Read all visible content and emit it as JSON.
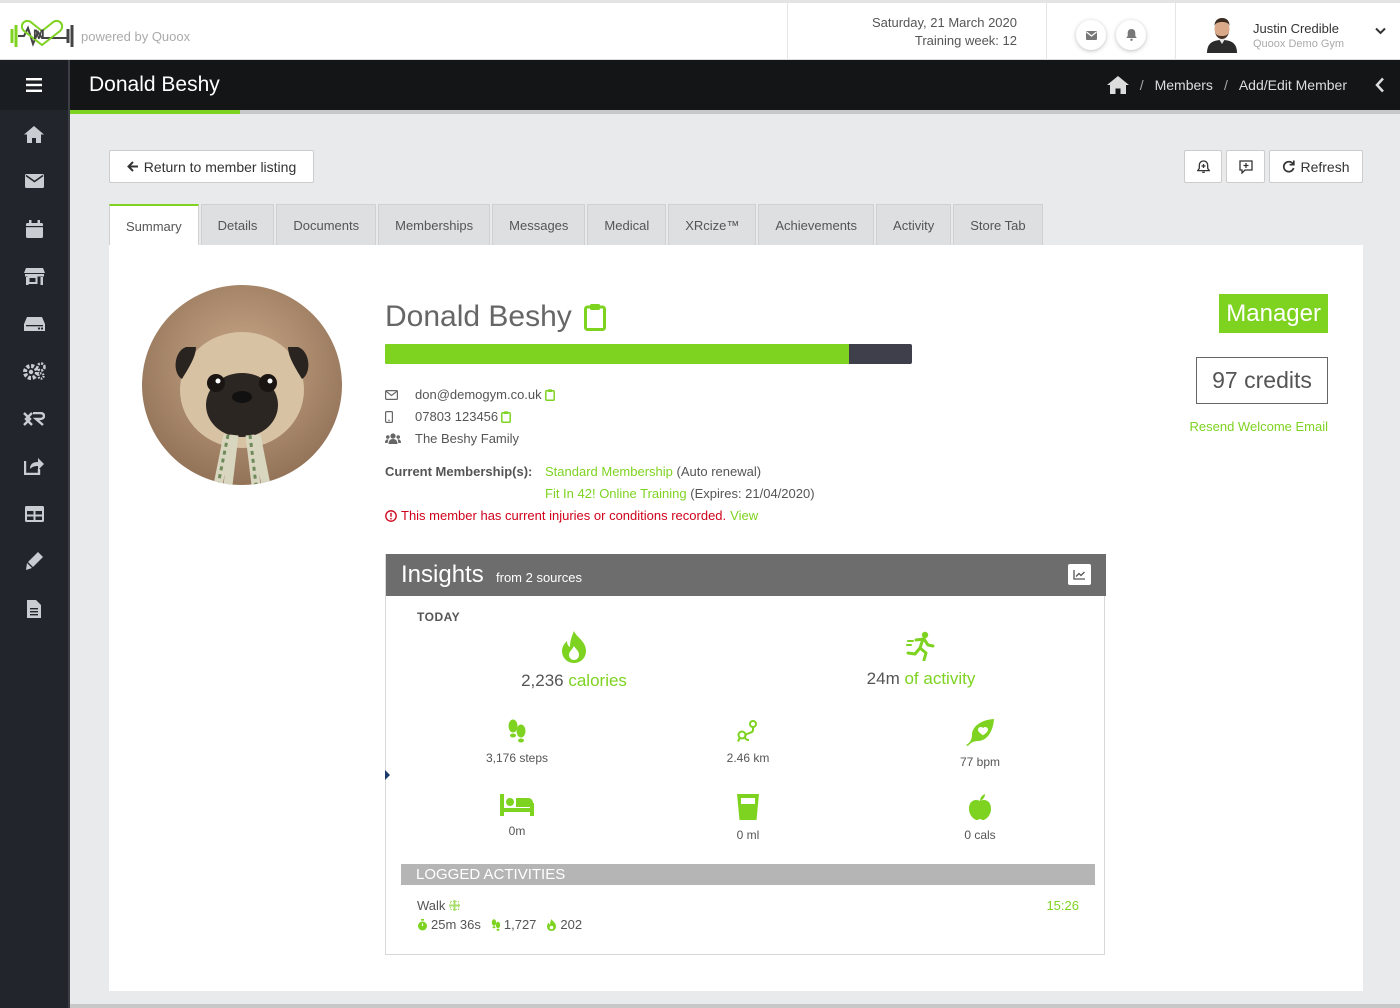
{
  "topbar": {
    "powered_by": "powered by Quoox",
    "date": "Saturday, 21 March 2020",
    "training_week": "Training week: 12",
    "user_name": "Justin Credible",
    "user_gym": "Quoox Demo Gym"
  },
  "sidebar": {
    "items": [
      "home-icon",
      "envelope-icon",
      "calendar-icon",
      "store-icon",
      "gear-icon",
      "xr-icon",
      "share-icon",
      "table-icon",
      "pen-icon",
      "document-icon"
    ]
  },
  "titlebar": {
    "title": "Donald Beshy",
    "breadcrumb_members": "Members",
    "breadcrumb_current": "Add/Edit Member",
    "separator": "/"
  },
  "actions": {
    "return_label": "Return to member listing",
    "refresh_label": "Refresh"
  },
  "tabs": [
    {
      "label": "Summary",
      "active": true
    },
    {
      "label": "Details"
    },
    {
      "label": "Documents"
    },
    {
      "label": "Memberships"
    },
    {
      "label": "Messages"
    },
    {
      "label": "Medical"
    },
    {
      "label": "XRcize™"
    },
    {
      "label": "Achievements"
    },
    {
      "label": "Activity"
    },
    {
      "label": "Store Tab"
    }
  ],
  "member": {
    "name": "Donald Beshy",
    "profile_progress_fraction": 0.88,
    "email": "don@demogym.co.uk",
    "phone": "07803 123456",
    "family": "The Beshy Family",
    "membership_label": "Current Membership(s):",
    "membership1_name": "Standard Membership",
    "membership1_note": "(Auto renewal)",
    "membership2_name": "Fit In 42! Online Training",
    "membership2_note": "(Expires: 21/04/2020)",
    "warning_text": "This member has current injuries or conditions recorded.",
    "warning_link": "View",
    "role": "Manager",
    "credits": "97 credits",
    "resend": "Resend Welcome Email"
  },
  "insights": {
    "title": "Insights",
    "subtitle": "from 2 sources",
    "today": "TODAY",
    "calories_value": "2,236",
    "calories_unit": "calories",
    "activity_value": "24m",
    "activity_unit": "of activity",
    "steps": "3,176 steps",
    "distance": "2.46 km",
    "heart": "77 bpm",
    "sleep": "0m",
    "water": "0 ml",
    "food": "0 cals",
    "logged_title": "LOGGED ACTIVITIES",
    "activity_name": "Walk",
    "activity_time": "15:26",
    "activity_duration": "25m 36s",
    "activity_steps": "1,727",
    "activity_cals": "202"
  },
  "colors": {
    "accent": "#7ed321",
    "dark": "#131517",
    "sidebar": "#22262c",
    "warning": "#d0021b"
  }
}
